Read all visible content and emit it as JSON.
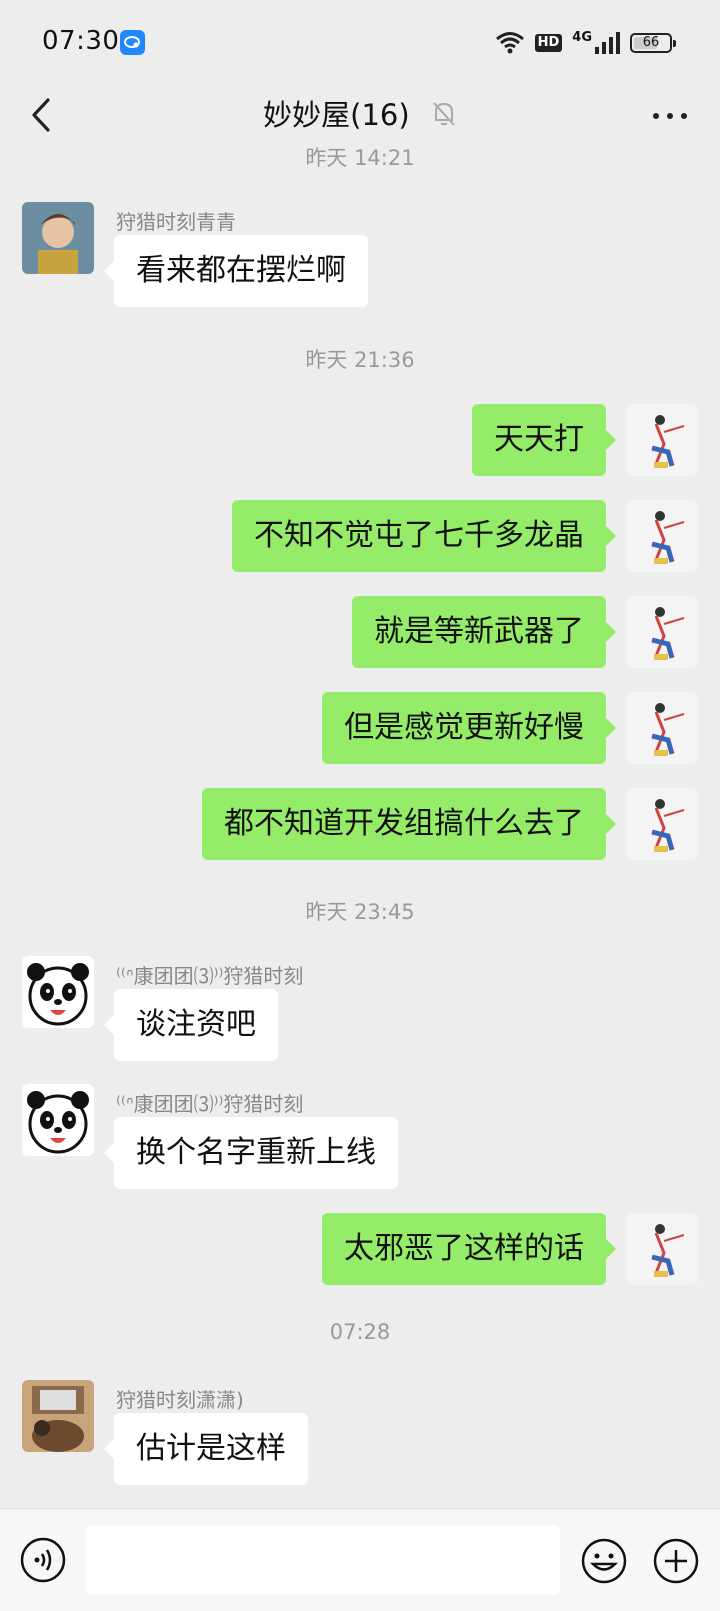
{
  "status_bar": {
    "time": "07:30",
    "hd_label": "HD",
    "network": "4G",
    "battery": "66"
  },
  "nav": {
    "title": "妙妙屋(16)",
    "back_icon": "chevron-left-icon",
    "more_icon": "more-dots-icon",
    "mute_icon": "bell-muted-icon"
  },
  "messages": {
    "ts0": "昨天 14:21",
    "m1_sender": "狩猎时刻青青",
    "m1_text": "看来都在摆烂啊",
    "ts1": "昨天 21:36",
    "m2_text": "天天打",
    "m3_text": "不知不觉屯了七千多龙晶",
    "m4_text": "就是等新武器了",
    "m5_text": "但是感觉更新好慢",
    "m6_text": "都不知道开发组搞什么去了",
    "ts2": "昨天 23:45",
    "m7_sender": "⁽⁽ᐢ康团团⑶⁾⁾狩猎时刻",
    "m7_text": "谈注资吧",
    "m8_sender": "⁽⁽ᐢ康团团⑶⁾⁾狩猎时刻",
    "m8_text": "换个名字重新上线",
    "m9_text": "太邪恶了这样的话",
    "ts3": "07:28",
    "m10_sender": "狩猎时刻潇潇)",
    "m10_text": "估计是这样"
  },
  "input_bar": {
    "value": "",
    "placeholder": ""
  },
  "colors": {
    "background": "#ededed",
    "outgoing_bubble": "#95ec69",
    "incoming_bubble": "#ffffff"
  }
}
